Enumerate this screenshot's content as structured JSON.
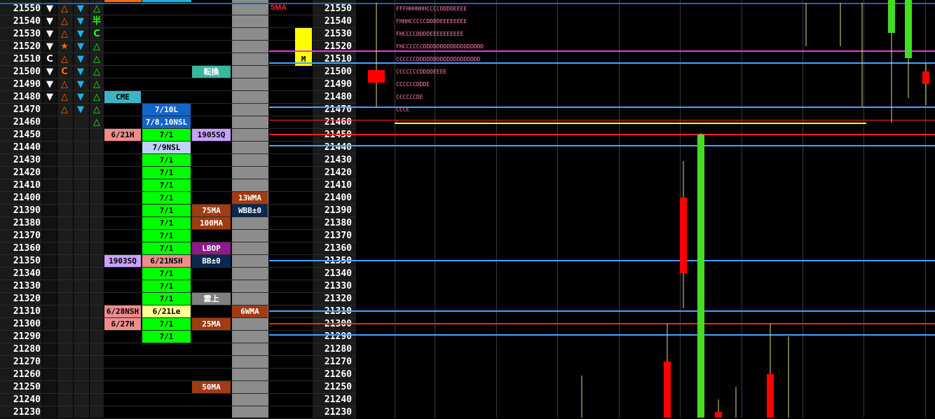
{
  "colors": {
    "white": "#ffffff",
    "orange": "#ff6a00",
    "cyan": "#19b4e6",
    "green": "#14ff14",
    "lime": "#00ff00",
    "teal": "#3cb4a0",
    "pink": "#f08c8c",
    "lavender": "#c8a0ff",
    "brown": "#a03c14",
    "navy": "#0a2850",
    "purple": "#8c1a8c",
    "blue": "#1464c8",
    "lightblue": "#bed2ff",
    "yellow": "#ffff8c",
    "gray": "#808080",
    "red": "#ff0000"
  },
  "prices": [
    "21550",
    "21540",
    "21530",
    "21520",
    "21510",
    "21500",
    "21490",
    "21480",
    "21470",
    "21460",
    "21450",
    "21440",
    "21430",
    "21420",
    "21410",
    "21400",
    "21390",
    "21380",
    "21370",
    "21360",
    "21350",
    "21340",
    "21330",
    "21320",
    "21310",
    "21300",
    "21290",
    "21280",
    "21270",
    "21260",
    "21250",
    "21240",
    "21230"
  ],
  "symbols": [
    [
      "▼",
      "△",
      "▼",
      "△"
    ],
    [
      "▼",
      "△",
      "▼",
      "半"
    ],
    [
      "▼",
      "△",
      "▼",
      "C"
    ],
    [
      "▼",
      "★",
      "▼",
      "△"
    ],
    [
      "C",
      "△",
      "▼",
      "△"
    ],
    [
      "▼",
      "C",
      "▼",
      "△"
    ],
    [
      "▼",
      "△",
      "▼",
      "△"
    ],
    [
      "▼",
      "△",
      "▼",
      "△"
    ],
    [
      "",
      "△",
      "▼",
      "△"
    ],
    [
      "",
      "",
      "",
      "△"
    ]
  ],
  "symbol_colors": {
    "▼": "#ffffff",
    "△": "#ff6a00",
    "★": "#ff6a00",
    "C": "#ffffff",
    "半": "#14ff14"
  },
  "col3_colors": [
    "#19b4e6",
    "#19b4e6",
    "#19b4e6",
    "#19b4e6",
    "#19b4e6",
    "#19b4e6",
    "#19b4e6",
    "#19b4e6",
    "#19b4e6",
    ""
  ],
  "col4_colors": [
    "#14ff14",
    "#14ff14",
    "#14ff14",
    "#14ff14",
    "#14ff14",
    "#14ff14",
    "#14ff14",
    "#14ff14",
    "#14ff14",
    "#14ff14"
  ],
  "col1_override": {
    "4": "#ffffff",
    "5": "#ff6a00"
  },
  "col4_override": {
    "2": "#14ff14"
  },
  "labels_col1": [
    {
      "row": 7,
      "text": "CME",
      "bg": "#3cb4c8",
      "fg": "#000000"
    },
    {
      "row": 10,
      "text": "6/21H",
      "bg": "#f08c8c",
      "fg": "#000000"
    },
    {
      "row": 20,
      "text": "1903SQ",
      "bg": "#c8a0ff",
      "fg": "#000000"
    },
    {
      "row": 24,
      "text": "6/28NSH",
      "bg": "#f08c8c",
      "fg": "#000000"
    },
    {
      "row": 25,
      "text": "6/27H",
      "bg": "#f08c8c",
      "fg": "#000000"
    }
  ],
  "labels_col2": [
    {
      "row": 8,
      "text": "7/10L",
      "bg": "#1464c8",
      "fg": "#ffffff"
    },
    {
      "row": 9,
      "text": "7/8,10NSL",
      "bg": "#1464c8",
      "fg": "#ffffff"
    },
    {
      "row": 10,
      "text": "7/1",
      "bg": "#00ff00",
      "fg": "#000000"
    },
    {
      "row": 11,
      "text": "7/9NSL",
      "bg": "#bed2ff",
      "fg": "#000000"
    },
    {
      "row": 12,
      "text": "7/1",
      "bg": "#00ff00",
      "fg": "#000000"
    },
    {
      "row": 13,
      "text": "7/1",
      "bg": "#00ff00",
      "fg": "#000000"
    },
    {
      "row": 14,
      "text": "7/1",
      "bg": "#00ff00",
      "fg": "#000000"
    },
    {
      "row": 15,
      "text": "7/1",
      "bg": "#00ff00",
      "fg": "#000000"
    },
    {
      "row": 16,
      "text": "7/1",
      "bg": "#00ff00",
      "fg": "#000000"
    },
    {
      "row": 17,
      "text": "7/1",
      "bg": "#00ff00",
      "fg": "#000000"
    },
    {
      "row": 18,
      "text": "7/1",
      "bg": "#00ff00",
      "fg": "#000000"
    },
    {
      "row": 19,
      "text": "7/1",
      "bg": "#00ff00",
      "fg": "#000000"
    },
    {
      "row": 20,
      "text": "6/21NSH",
      "bg": "#f08c8c",
      "fg": "#000000"
    },
    {
      "row": 21,
      "text": "7/1",
      "bg": "#00ff00",
      "fg": "#000000"
    },
    {
      "row": 22,
      "text": "7/1",
      "bg": "#00ff00",
      "fg": "#000000"
    },
    {
      "row": 23,
      "text": "7/1",
      "bg": "#00ff00",
      "fg": "#000000"
    },
    {
      "row": 24,
      "text": "6/21Le",
      "bg": "#ffff96",
      "fg": "#000000"
    },
    {
      "row": 25,
      "text": "7/1",
      "bg": "#00ff00",
      "fg": "#000000"
    },
    {
      "row": 26,
      "text": "7/1",
      "bg": "#00ff00",
      "fg": "#000000"
    }
  ],
  "labels_col3": [
    {
      "row": 5,
      "text": "転換",
      "bg": "#3cb4a0",
      "fg": "#ffffff"
    },
    {
      "row": 10,
      "text": "1905SQ",
      "bg": "#c8a0ff",
      "fg": "#000000"
    },
    {
      "row": 16,
      "text": "75MA",
      "bg": "#a03c14",
      "fg": "#ffffff"
    },
    {
      "row": 17,
      "text": "100MA",
      "bg": "#a03c14",
      "fg": "#ffffff"
    },
    {
      "row": 19,
      "text": "LBOP",
      "bg": "#8c1a8c",
      "fg": "#ffffff"
    },
    {
      "row": 20,
      "text": "BB±0",
      "bg": "#0a2850",
      "fg": "#ffffff"
    },
    {
      "row": 23,
      "text": "雲上",
      "bg": "#808080",
      "fg": "#ffffff"
    },
    {
      "row": 25,
      "text": "25MA",
      "bg": "#a03c14",
      "fg": "#ffffff"
    },
    {
      "row": 30,
      "text": "50MA",
      "bg": "#a03c14",
      "fg": "#ffffff"
    }
  ],
  "labels_col4": [
    {
      "row": 15,
      "text": "13WMA",
      "bg": "#a03c14",
      "fg": "#ffffff"
    },
    {
      "row": 16,
      "text": "WBB±0",
      "bg": "#0a2850",
      "fg": "#ffffff"
    },
    {
      "row": 24,
      "text": "6WMA",
      "bg": "#a03c14",
      "fg": "#ffffff"
    }
  ],
  "ma_label": "5MA",
  "ma_marker": "M",
  "tpo": [
    {
      "row": 0,
      "text": "FFFHHHHHHCCCCDDDDEEEE"
    },
    {
      "row": 1,
      "text": "FHHHCCCCCDDDDEEEEEEEE"
    },
    {
      "row": 2,
      "text": "FHCCCCDDDDEEEEEEEEEE"
    },
    {
      "row": 3,
      "text": "FHCCCCCCDDDDDDDDDDDDDDDDDD"
    },
    {
      "row": 4,
      "text": "CCCCCCDDDDDDDDDDDDDDDDDDD"
    },
    {
      "row": 5,
      "text": "CCCCCCCDDDDEEEE"
    },
    {
      "row": 6,
      "text": "CCCCCCDDDE"
    },
    {
      "row": 7,
      "text": "CCCCCCDE"
    },
    {
      "row": 8,
      "text": "CCCE"
    },
    {
      "row": 9,
      "text": "C"
    }
  ]
}
